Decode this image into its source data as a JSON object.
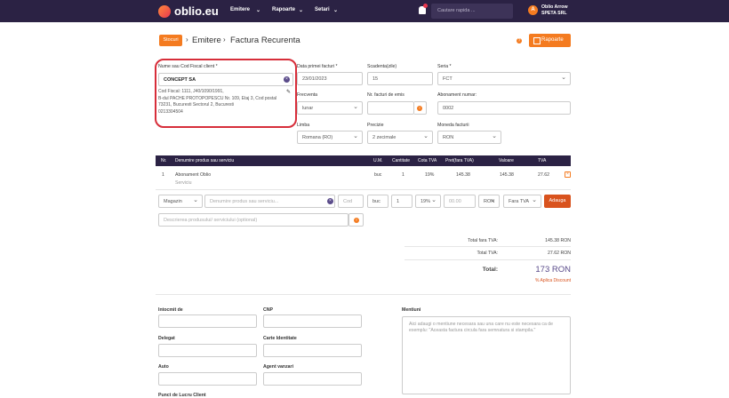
{
  "topbar": {
    "logo": "oblio.eu",
    "nav": [
      "Emitere",
      "Rapoarte",
      "Setari"
    ],
    "search_placeholder": "Cautare rapida ...",
    "avatar_letter": "A",
    "user_name": "Oblio Arrow",
    "company": "SPETA SRL"
  },
  "breadcrumb": {
    "stocuri": "Stocuri",
    "emitere": "Emitere",
    "page": "Factura Recurenta",
    "rapoarte_button": "Rapoarte"
  },
  "client": {
    "label": "Nume sau Cod Fiscal client *",
    "value": "CONCEPT SA",
    "address": [
      "Cod Fiscal: 1111, J40/1090/1991,",
      "B-dul PACHE PROTOPOPESCU Nr. 109, Etaj 3, Cod postal",
      "73231, Bucuresti Sectorul 2, Bucuresti",
      "0213304504"
    ]
  },
  "form": {
    "data_primei_label": "Data primei facturi *",
    "data_primei_value": "23/01/2023",
    "scadenta_label": "Scadenta(zile)",
    "scadenta_value": "15",
    "seria_label": "Seria *",
    "seria_value": "FCT",
    "frecventa_label": "Frecventa",
    "frecventa_value": "lunar",
    "nr_facturi_label": "Nr. facturi de emis",
    "nr_facturi_value": "",
    "abonament_label": "Abonament numar:",
    "abonament_value": "0002",
    "limba_label": "Limba",
    "limba_value": "Romana (RO)",
    "precizie_label": "Precizie",
    "precizie_value": "2 zecimale",
    "moneda_label": "Moneda facturii",
    "moneda_value": "RON"
  },
  "table": {
    "headers": [
      "Nr.",
      "Denumire produs sau serviciu",
      "U.M.",
      "Cantitate",
      "Cota TVA",
      "Pret(fara TVA)",
      "Valoare",
      "TVA"
    ],
    "rows": [
      {
        "nr": "1",
        "name": "Abonament Oblio",
        "type": "Serviciu",
        "um": "buc",
        "cant": "1",
        "cota": "19%",
        "pret": "145.38",
        "valoare": "145.38",
        "tva": "27.62"
      }
    ]
  },
  "add_row": {
    "gestiune": "Magazin",
    "produs_placeholder": "Denumire produs sau serviciu...",
    "cod_placeholder": "Cod",
    "um": "buc",
    "cantitate": "1",
    "cota": "19%",
    "pret_placeholder": "00.00",
    "moneda": "RON",
    "tva_option": "Fara TVA",
    "add_button": "Adauga",
    "descriere_placeholder": "Descrierea produsului/ serviciului (optional)"
  },
  "totals": {
    "fara_tva_label": "Total fara TVA:",
    "fara_tva_value": "145.38 RON",
    "tva_label": "Total TVA:",
    "tva_value": "27.62 RON",
    "total_label": "Total:",
    "total_value": "173 RON",
    "discount": "% Aplica Discount"
  },
  "footer": {
    "intocmit_label": "Intocmit de",
    "cnp_label": "CNP",
    "delegat_label": "Delegat",
    "carte_label": "Carte Identitate",
    "auto_label": "Auto",
    "agent_label": "Agent vanzari",
    "punct_label": "Punct de Lucru Client",
    "mentiuni_label": "Mentiuni",
    "mentiuni_placeholder": "Aici adaugi o mentiune necesara sau una care nu este necesara ca de exemplu: \"Aceasta factura circula fara semnatura si stampila.\""
  },
  "colors": {
    "accent": "#f47b20",
    "navbar": "#2b2244",
    "highlight": "#d72e3a",
    "total": "#5a4b8a"
  }
}
